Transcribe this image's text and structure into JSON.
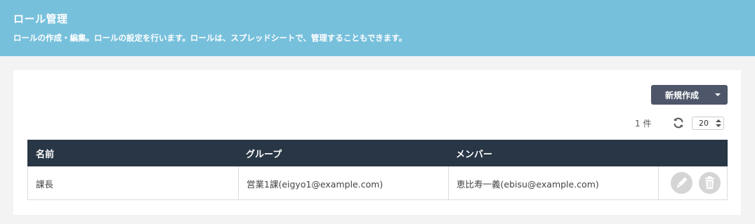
{
  "header": {
    "title": "ロール管理",
    "description": "ロールの作成・編集。ロールの設定を行います。ロールは、スプレッドシートで、管理することもできます。"
  },
  "toolbar": {
    "new_button_label": "新規作成",
    "count_text": "1 件",
    "per_page_value": "20"
  },
  "table": {
    "columns": [
      "名前",
      "グループ",
      "メンバー"
    ],
    "rows": [
      {
        "name": "課長",
        "group": "営業1課(eigyo1@example.com)",
        "member": "恵比寿一義(ebisu@example.com)"
      }
    ]
  },
  "colors": {
    "header_bg": "#77c0dc",
    "table_header_bg": "#283645",
    "button_bg": "#4e5769",
    "action_icon_bg": "#d5d5d5"
  },
  "icons": {
    "refresh": "refresh-icon",
    "edit": "pencil-icon",
    "delete": "trash-icon",
    "dropdown": "caret-down-icon"
  }
}
